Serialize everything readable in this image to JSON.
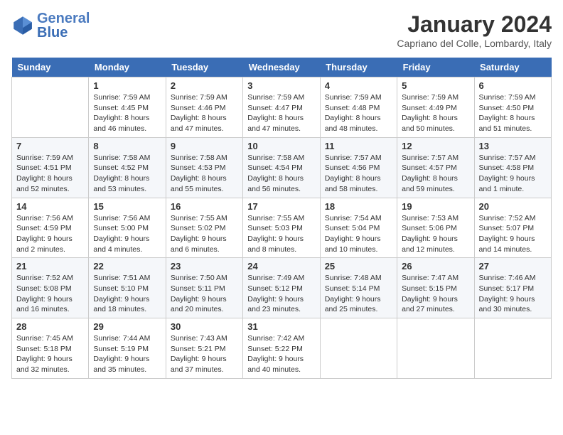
{
  "header": {
    "logo_line1": "General",
    "logo_line2": "Blue",
    "month_year": "January 2024",
    "location": "Capriano del Colle, Lombardy, Italy"
  },
  "weekdays": [
    "Sunday",
    "Monday",
    "Tuesday",
    "Wednesday",
    "Thursday",
    "Friday",
    "Saturday"
  ],
  "weeks": [
    [
      {
        "num": "",
        "info": ""
      },
      {
        "num": "1",
        "info": "Sunrise: 7:59 AM\nSunset: 4:45 PM\nDaylight: 8 hours\nand 46 minutes."
      },
      {
        "num": "2",
        "info": "Sunrise: 7:59 AM\nSunset: 4:46 PM\nDaylight: 8 hours\nand 47 minutes."
      },
      {
        "num": "3",
        "info": "Sunrise: 7:59 AM\nSunset: 4:47 PM\nDaylight: 8 hours\nand 47 minutes."
      },
      {
        "num": "4",
        "info": "Sunrise: 7:59 AM\nSunset: 4:48 PM\nDaylight: 8 hours\nand 48 minutes."
      },
      {
        "num": "5",
        "info": "Sunrise: 7:59 AM\nSunset: 4:49 PM\nDaylight: 8 hours\nand 50 minutes."
      },
      {
        "num": "6",
        "info": "Sunrise: 7:59 AM\nSunset: 4:50 PM\nDaylight: 8 hours\nand 51 minutes."
      }
    ],
    [
      {
        "num": "7",
        "info": "Sunrise: 7:59 AM\nSunset: 4:51 PM\nDaylight: 8 hours\nand 52 minutes."
      },
      {
        "num": "8",
        "info": "Sunrise: 7:58 AM\nSunset: 4:52 PM\nDaylight: 8 hours\nand 53 minutes."
      },
      {
        "num": "9",
        "info": "Sunrise: 7:58 AM\nSunset: 4:53 PM\nDaylight: 8 hours\nand 55 minutes."
      },
      {
        "num": "10",
        "info": "Sunrise: 7:58 AM\nSunset: 4:54 PM\nDaylight: 8 hours\nand 56 minutes."
      },
      {
        "num": "11",
        "info": "Sunrise: 7:57 AM\nSunset: 4:56 PM\nDaylight: 8 hours\nand 58 minutes."
      },
      {
        "num": "12",
        "info": "Sunrise: 7:57 AM\nSunset: 4:57 PM\nDaylight: 8 hours\nand 59 minutes."
      },
      {
        "num": "13",
        "info": "Sunrise: 7:57 AM\nSunset: 4:58 PM\nDaylight: 9 hours\nand 1 minute."
      }
    ],
    [
      {
        "num": "14",
        "info": "Sunrise: 7:56 AM\nSunset: 4:59 PM\nDaylight: 9 hours\nand 2 minutes."
      },
      {
        "num": "15",
        "info": "Sunrise: 7:56 AM\nSunset: 5:00 PM\nDaylight: 9 hours\nand 4 minutes."
      },
      {
        "num": "16",
        "info": "Sunrise: 7:55 AM\nSunset: 5:02 PM\nDaylight: 9 hours\nand 6 minutes."
      },
      {
        "num": "17",
        "info": "Sunrise: 7:55 AM\nSunset: 5:03 PM\nDaylight: 9 hours\nand 8 minutes."
      },
      {
        "num": "18",
        "info": "Sunrise: 7:54 AM\nSunset: 5:04 PM\nDaylight: 9 hours\nand 10 minutes."
      },
      {
        "num": "19",
        "info": "Sunrise: 7:53 AM\nSunset: 5:06 PM\nDaylight: 9 hours\nand 12 minutes."
      },
      {
        "num": "20",
        "info": "Sunrise: 7:52 AM\nSunset: 5:07 PM\nDaylight: 9 hours\nand 14 minutes."
      }
    ],
    [
      {
        "num": "21",
        "info": "Sunrise: 7:52 AM\nSunset: 5:08 PM\nDaylight: 9 hours\nand 16 minutes."
      },
      {
        "num": "22",
        "info": "Sunrise: 7:51 AM\nSunset: 5:10 PM\nDaylight: 9 hours\nand 18 minutes."
      },
      {
        "num": "23",
        "info": "Sunrise: 7:50 AM\nSunset: 5:11 PM\nDaylight: 9 hours\nand 20 minutes."
      },
      {
        "num": "24",
        "info": "Sunrise: 7:49 AM\nSunset: 5:12 PM\nDaylight: 9 hours\nand 23 minutes."
      },
      {
        "num": "25",
        "info": "Sunrise: 7:48 AM\nSunset: 5:14 PM\nDaylight: 9 hours\nand 25 minutes."
      },
      {
        "num": "26",
        "info": "Sunrise: 7:47 AM\nSunset: 5:15 PM\nDaylight: 9 hours\nand 27 minutes."
      },
      {
        "num": "27",
        "info": "Sunrise: 7:46 AM\nSunset: 5:17 PM\nDaylight: 9 hours\nand 30 minutes."
      }
    ],
    [
      {
        "num": "28",
        "info": "Sunrise: 7:45 AM\nSunset: 5:18 PM\nDaylight: 9 hours\nand 32 minutes."
      },
      {
        "num": "29",
        "info": "Sunrise: 7:44 AM\nSunset: 5:19 PM\nDaylight: 9 hours\nand 35 minutes."
      },
      {
        "num": "30",
        "info": "Sunrise: 7:43 AM\nSunset: 5:21 PM\nDaylight: 9 hours\nand 37 minutes."
      },
      {
        "num": "31",
        "info": "Sunrise: 7:42 AM\nSunset: 5:22 PM\nDaylight: 9 hours\nand 40 minutes."
      },
      {
        "num": "",
        "info": ""
      },
      {
        "num": "",
        "info": ""
      },
      {
        "num": "",
        "info": ""
      }
    ]
  ]
}
